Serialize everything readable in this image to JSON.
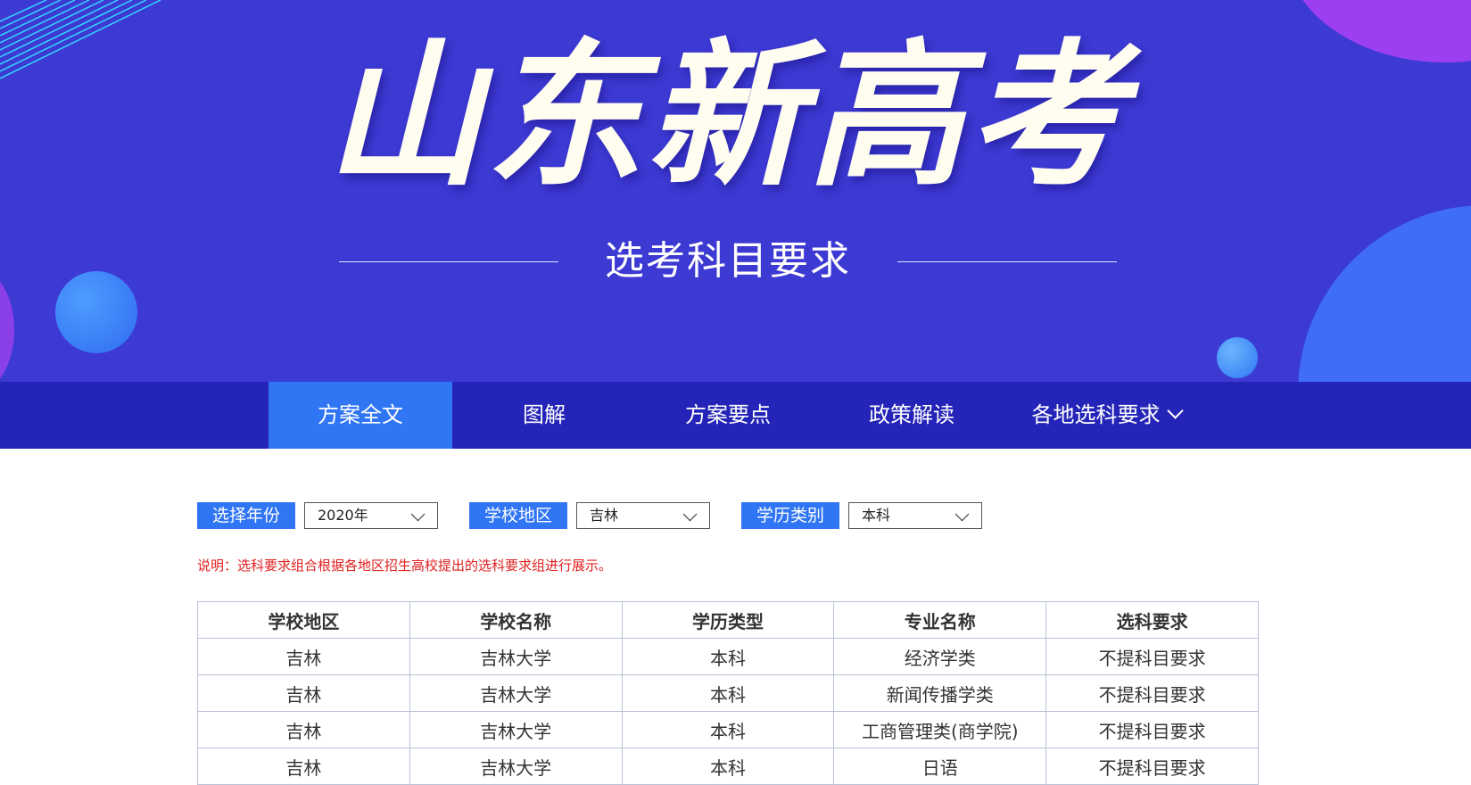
{
  "banner": {
    "title": "山东新高考",
    "subtitle": "选考科目要求"
  },
  "colors": {
    "banner_bg": "#3d3ad4",
    "nav_bg": "#2425b8",
    "accent": "#2f75f4",
    "note": "#e02020"
  },
  "nav": {
    "items": [
      {
        "label": "方案全文",
        "active": true
      },
      {
        "label": "图解"
      },
      {
        "label": "方案要点"
      },
      {
        "label": "政策解读"
      },
      {
        "label": "各地选科要求",
        "has_dropdown": true,
        "icon": "chevron-down-icon"
      }
    ]
  },
  "filters": {
    "year": {
      "label": "选择年份",
      "value": "2020年"
    },
    "region": {
      "label": "学校地区",
      "value": "吉林"
    },
    "level": {
      "label": "学历类别",
      "value": "本科"
    }
  },
  "note": "说明：选科要求组合根据各地区招生高校提出的选科要求组进行展示。",
  "table": {
    "headers": [
      "学校地区",
      "学校名称",
      "学历类型",
      "专业名称",
      "选科要求"
    ],
    "rows": [
      [
        "吉林",
        "吉林大学",
        "本科",
        "经济学类",
        "不提科目要求"
      ],
      [
        "吉林",
        "吉林大学",
        "本科",
        "新闻传播学类",
        "不提科目要求"
      ],
      [
        "吉林",
        "吉林大学",
        "本科",
        "工商管理类(商学院)",
        "不提科目要求"
      ],
      [
        "吉林",
        "吉林大学",
        "本科",
        "日语",
        "不提科目要求"
      ]
    ]
  }
}
